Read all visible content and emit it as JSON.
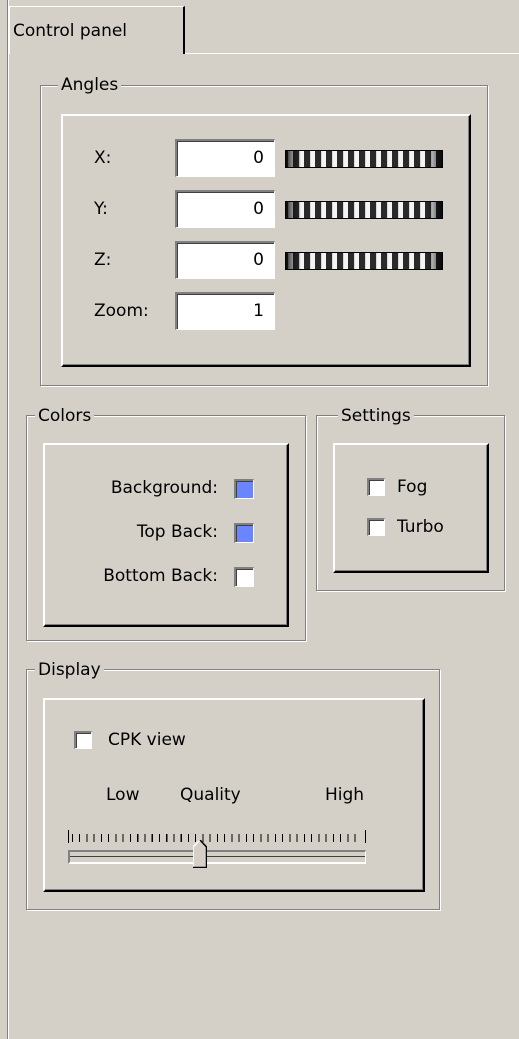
{
  "tab": {
    "label": "Control panel"
  },
  "angles": {
    "title": "Angles",
    "rows": [
      {
        "label": "X:",
        "value": "0"
      },
      {
        "label": "Y:",
        "value": "0"
      },
      {
        "label": "Z:",
        "value": "0"
      }
    ],
    "zoom": {
      "label": "Zoom:",
      "value": "1"
    }
  },
  "colors": {
    "title": "Colors",
    "items": [
      {
        "label": "Background:",
        "color": "#6b84ff"
      },
      {
        "label": "Top Back:",
        "color": "#6b84ff"
      },
      {
        "label": "Bottom Back:",
        "color": "#ffffff"
      }
    ]
  },
  "settings": {
    "title": "Settings",
    "fog": {
      "label": "Fog",
      "checked": false
    },
    "turbo": {
      "label": "Turbo",
      "checked": false
    }
  },
  "display": {
    "title": "Display",
    "cpk": {
      "label": "CPK view",
      "checked": false
    },
    "quality": {
      "low": "Low",
      "label": "Quality",
      "high": "High",
      "level": 0.44
    }
  }
}
